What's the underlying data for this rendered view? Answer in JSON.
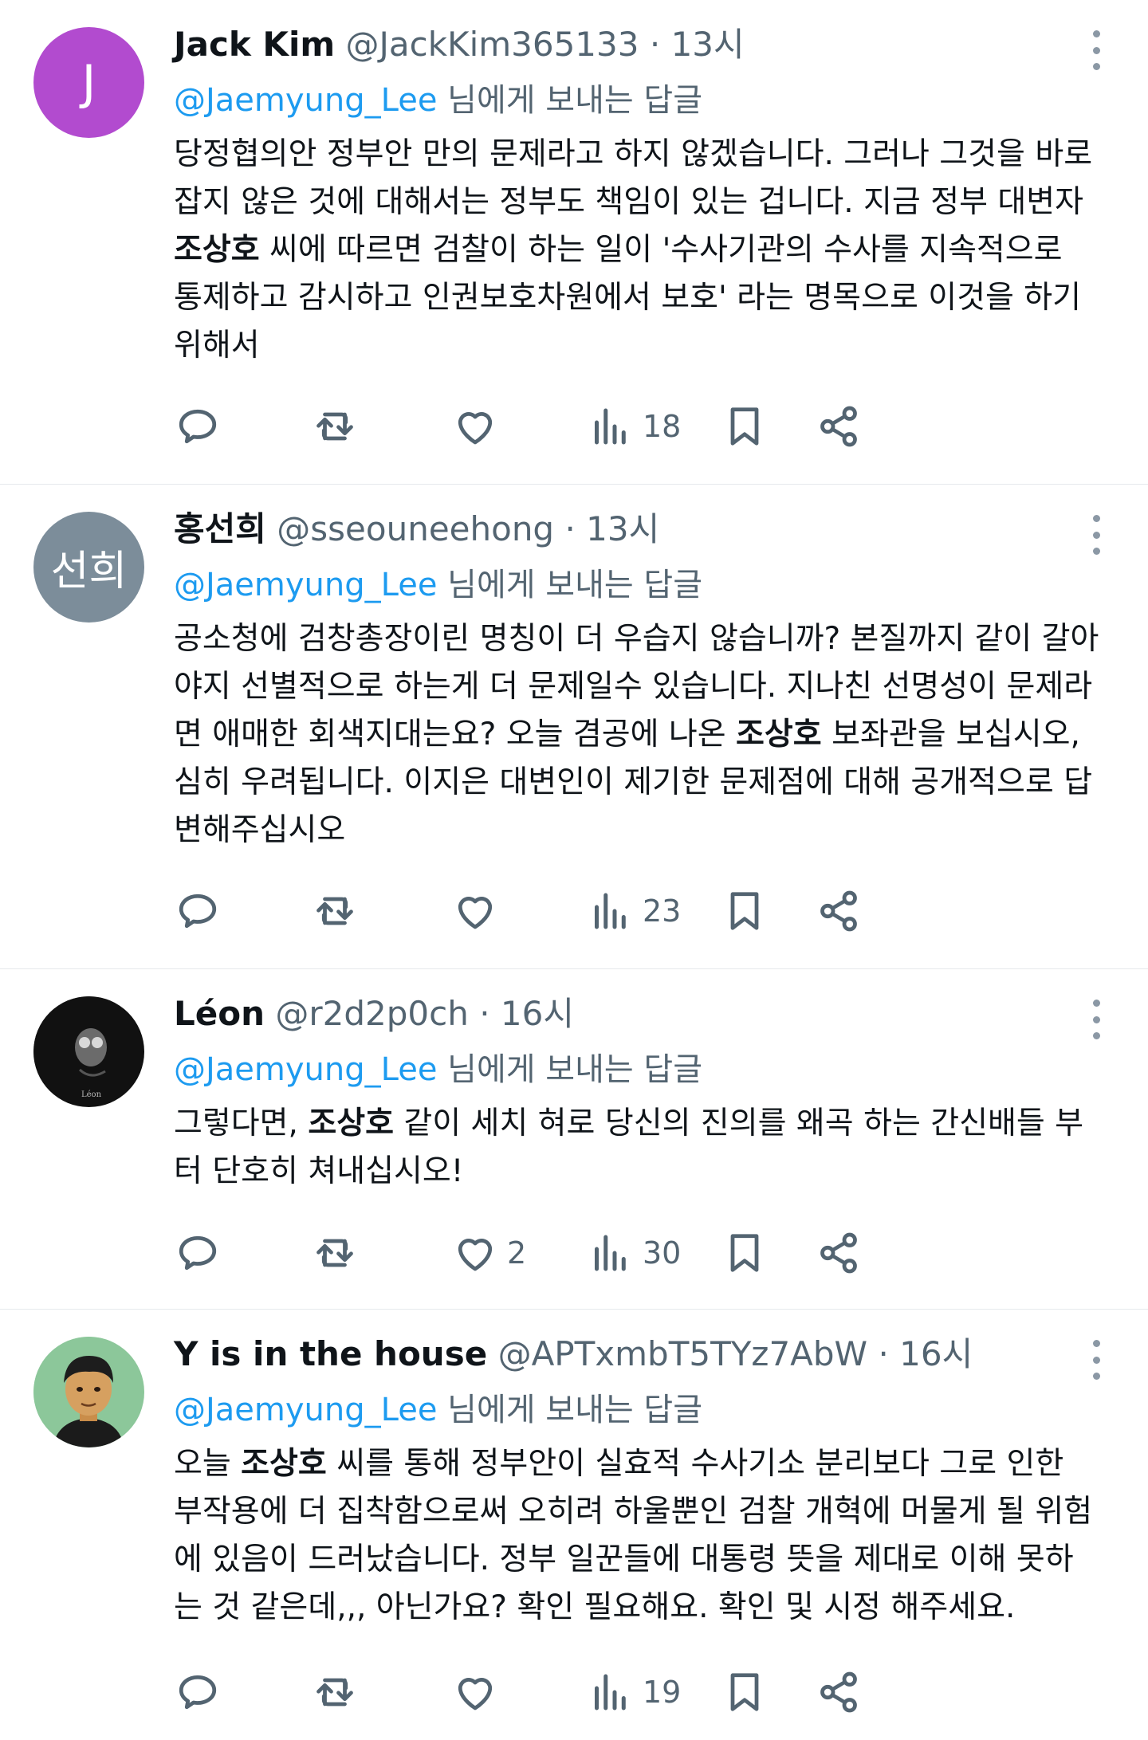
{
  "colors": {
    "accent": "#1d9bf0",
    "secondary_text": "#536471",
    "divider": "#e6e9ec"
  },
  "tweets": [
    {
      "avatar_letter": "J",
      "avatar_color": "#b24bcf",
      "name": "Jack Kim",
      "handle": "@JackKim365133",
      "time": "13시",
      "reply_to_handle": "@Jaemyung_Lee",
      "reply_to_suffix": " 님에게 보내는 답글",
      "text": [
        {
          "t": "당정협의안 정부안 만의 문제라고 하지 않겠습니다. 그러나 그것을 바로잡지 않은 것에 대해서는 정부도 책임이 있는 겁니다. 지금 정부 대변자 ",
          "b": false
        },
        {
          "t": "조상호",
          "b": true
        },
        {
          "t": " 씨에 따르면 검찰이 하는 일이 '수사기관의 수사를 지속적으로 통제하고 감시하고 인권보호차원에서 보호' 라는 명목으로 이것을 하기위해서",
          "b": false
        }
      ],
      "like_count": "",
      "view_count": "18"
    },
    {
      "avatar_letter": "선희",
      "avatar_color": "#7c8d9a",
      "name": "홍선희",
      "handle": "@sseouneehong",
      "time": "13시",
      "reply_to_handle": "@Jaemyung_Lee",
      "reply_to_suffix": " 님에게 보내는 답글",
      "text": [
        {
          "t": "공소청에 검창총장이린 명칭이 더 우습지 않습니까? 본질까지 같이 갈아야지 선별적으로 하는게 더 문제일수 있습니다. 지나친 선명성이 문제라면 애매한 회색지대는요? 오늘 겸공에 나온 ",
          "b": false
        },
        {
          "t": "조상호",
          "b": true
        },
        {
          "t": " 보좌관을 보십시오, 심히 우려됩니다. 이지은 대변인이 제기한 문제점에 대해 공개적으로 답변해주십시오",
          "b": false
        }
      ],
      "like_count": "",
      "view_count": "23"
    },
    {
      "avatar_letter": "",
      "avatar_color": "#111111",
      "name": "Léon",
      "handle": "@r2d2p0ch",
      "time": "16시",
      "reply_to_handle": "@Jaemyung_Lee",
      "reply_to_suffix": " 님에게 보내는 답글",
      "text": [
        {
          "t": "그렇다면, ",
          "b": false
        },
        {
          "t": "조상호",
          "b": true
        },
        {
          "t": " 같이 세치 혀로 당신의 진의를 왜곡 하는 간신배들 부터 단호히 쳐내십시오!",
          "b": false
        }
      ],
      "like_count": "2",
      "view_count": "30"
    },
    {
      "avatar_letter": "",
      "avatar_color": "#8cc79a",
      "name": "Y is in the house",
      "handle": "@APTxmbT5TYz7AbW",
      "time": "16시",
      "reply_to_handle": "@Jaemyung_Lee",
      "reply_to_suffix": " 님에게 보내는 답글",
      "text": [
        {
          "t": "오늘 ",
          "b": false
        },
        {
          "t": "조상호",
          "b": true
        },
        {
          "t": " 씨를 통해 정부안이 실효적 수사기소 분리보다 그로 인한 부작용에 더 집착함으로써 오히려 하울뿐인 검찰 개혁에 머물게 될 위험에 있음이 드러났습니다. 정부 일꾼들에 대통령 뜻을 제대로 이해 못하는 것 같은데,,, 아닌가요? 확인 필요해요. 확인 및 시정 해주세요.",
          "b": false
        }
      ],
      "like_count": "",
      "view_count": "19"
    }
  ]
}
